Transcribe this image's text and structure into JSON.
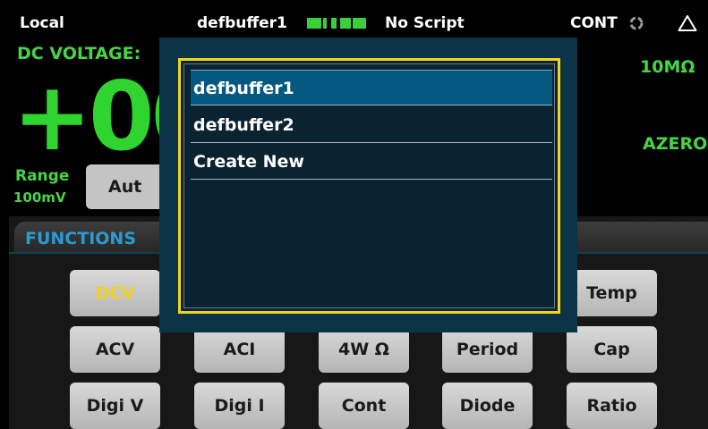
{
  "status_bar": {
    "mode": "Local",
    "buffer": "defbuffer1",
    "script": "No Script",
    "trigger_mode": "CONT",
    "activity_icon": "trigger-activity-icon",
    "warning_icon": "warning-triangle-icon"
  },
  "measurement": {
    "function_label": "DC VOLTAGE:",
    "reading": "+000",
    "input_impedance": "10MΩ",
    "autozero": "AZERO",
    "range_label": "Range",
    "range_value": "100mV",
    "range_button": "Aut"
  },
  "functions": {
    "title": "FUNCTIONS",
    "rows": [
      [
        "DCV",
        "",
        "",
        "",
        "Temp"
      ],
      [
        "ACV",
        "ACI",
        "4W Ω",
        "Period",
        "Cap"
      ],
      [
        "Digi V",
        "Digi I",
        "Cont",
        "Diode",
        "Ratio"
      ]
    ],
    "active": "DCV"
  },
  "buffer_menu": {
    "options": [
      "defbuffer1",
      "defbuffer2",
      "Create New"
    ],
    "selected": "defbuffer1"
  },
  "colors": {
    "reading_green": "#2fd42f",
    "accent_blue": "#2a9bd1",
    "dialog_border": "#f1d61a",
    "selected_option": "#03587f",
    "active_key_text": "#f4d21c"
  }
}
